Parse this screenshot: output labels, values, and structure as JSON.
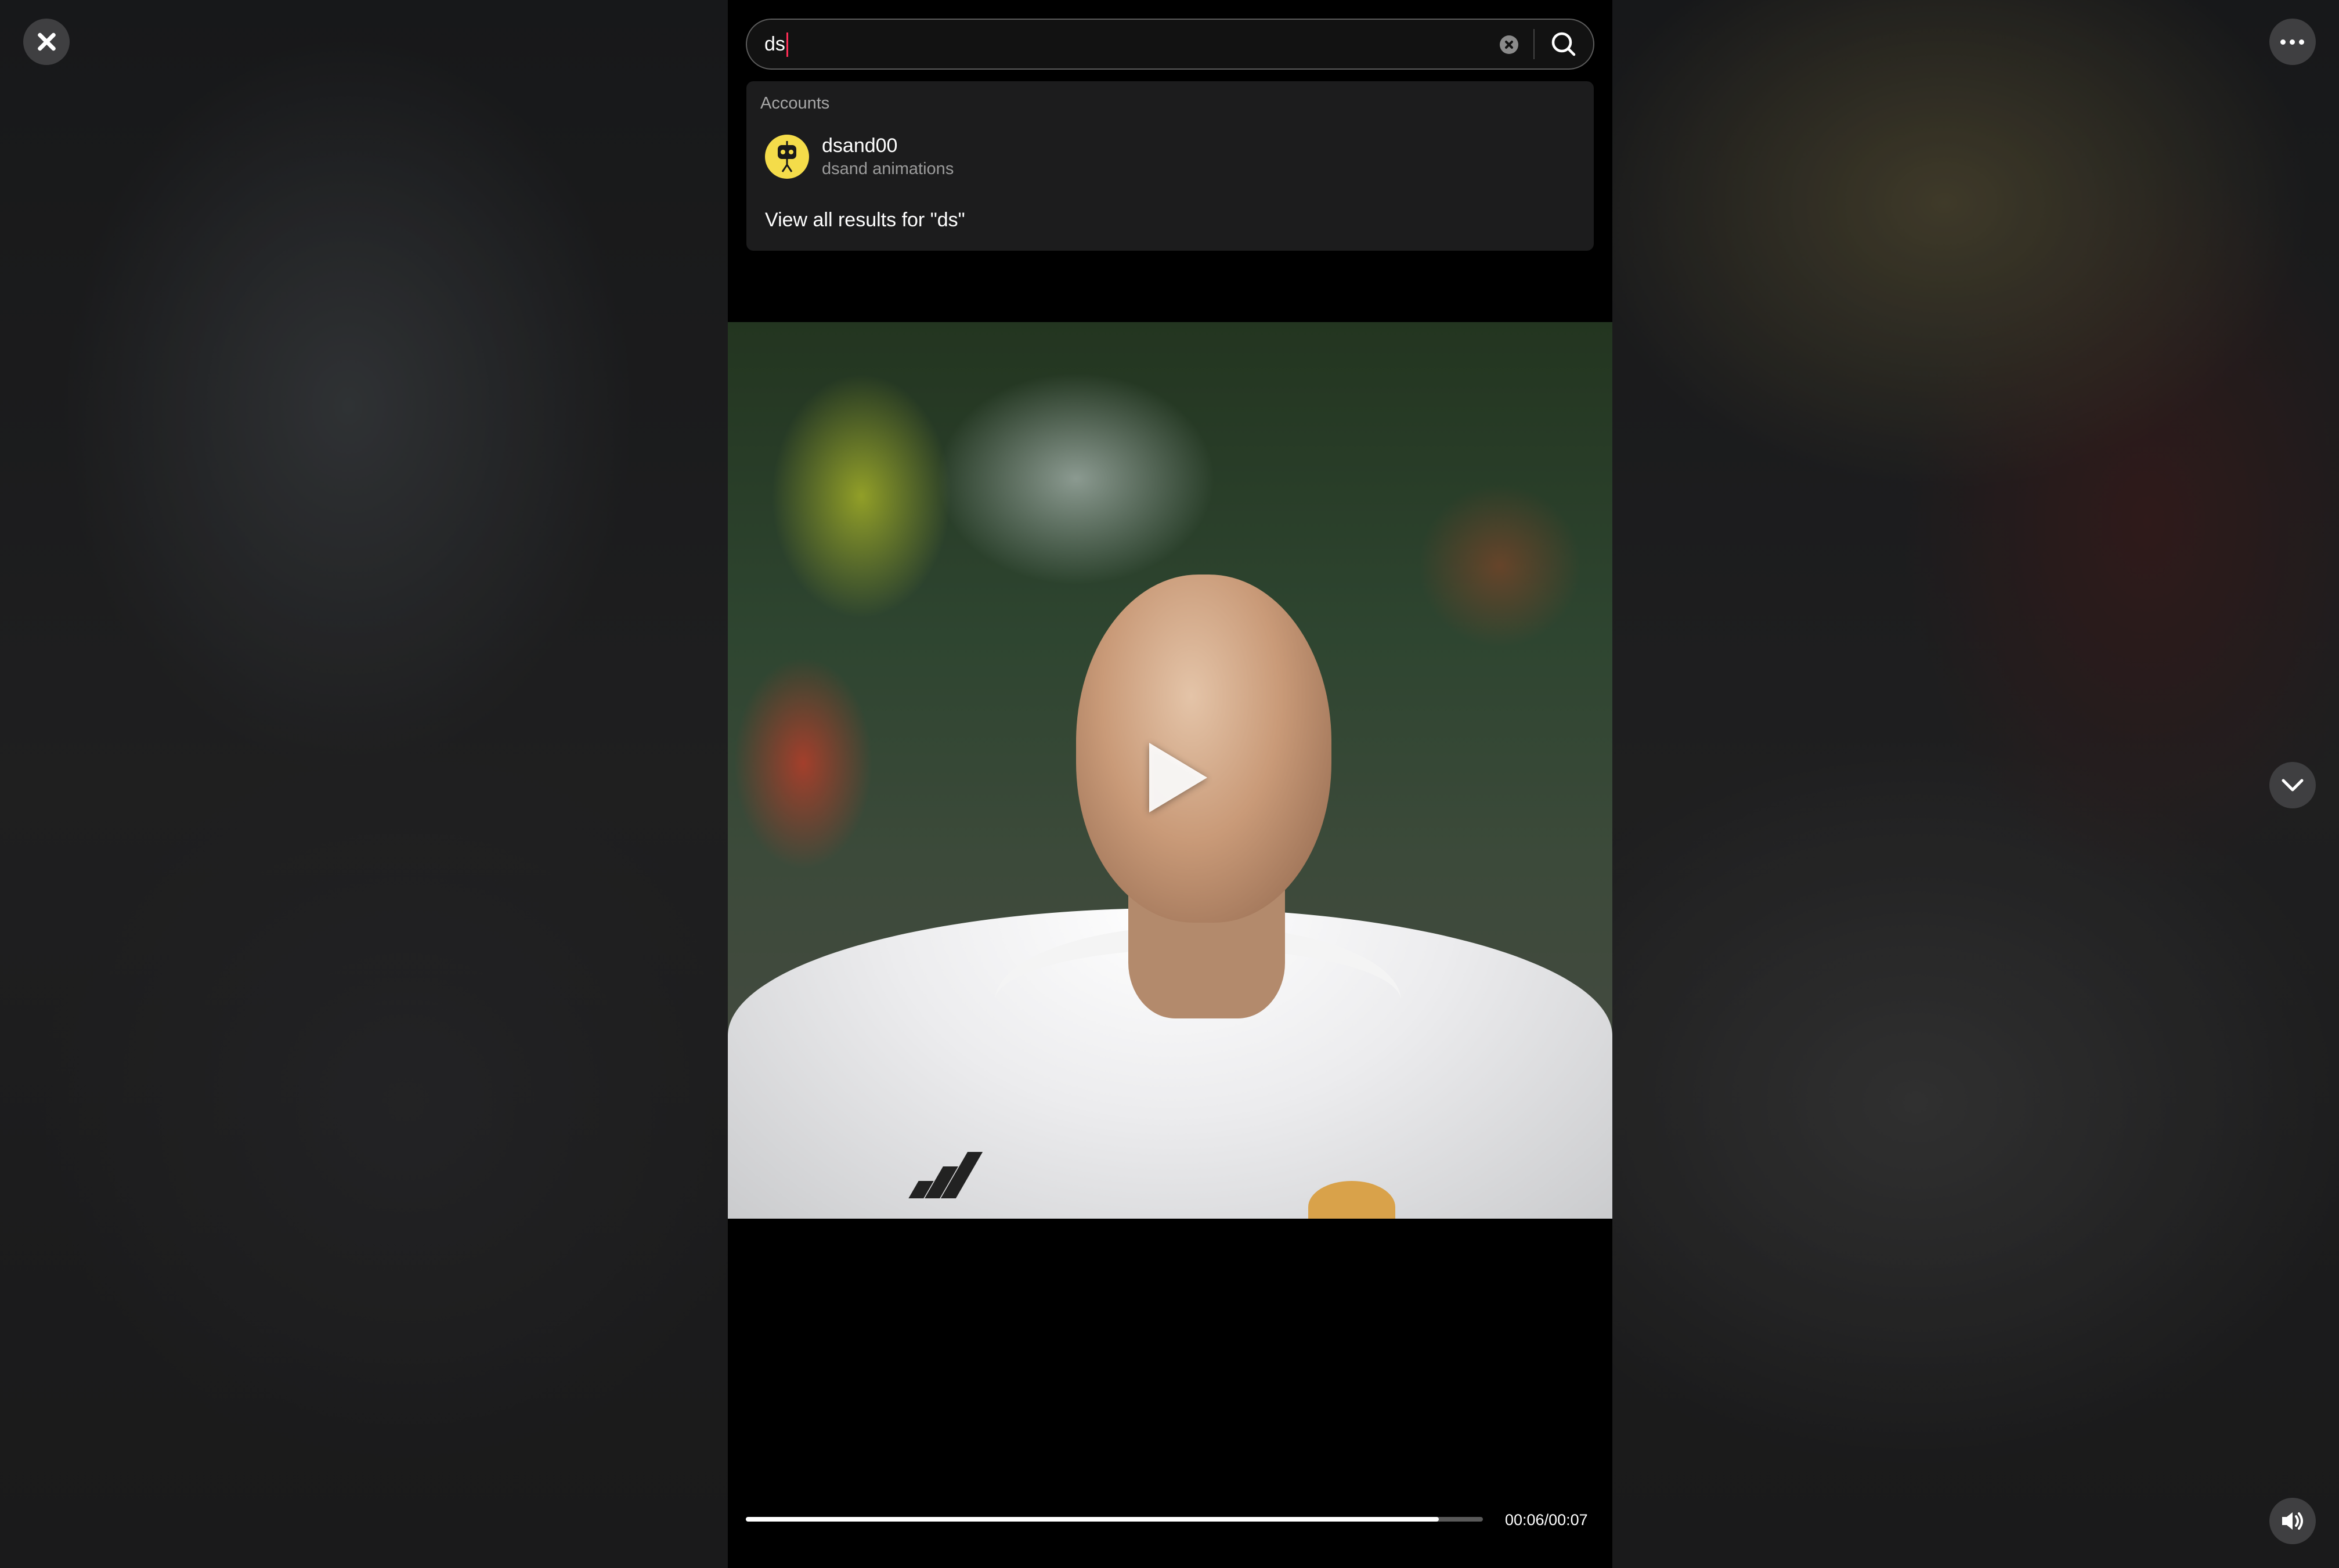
{
  "search": {
    "value": "ds",
    "placeholder": "Search"
  },
  "dropdown": {
    "section_title": "Accounts",
    "accounts": [
      {
        "username": "dsand00",
        "display_name": "dsand animations",
        "avatar_icon": "robot-avatar"
      }
    ],
    "view_all_label": "View all results for \"ds\""
  },
  "video": {
    "progress_fraction": 0.94,
    "current_time": "00:06",
    "duration": "00:07",
    "time_readout": "00:06/00:07",
    "state": "paused"
  },
  "icons": {
    "close": "close-icon",
    "more": "more-icon",
    "next": "chevron-down-icon",
    "volume": "volume-icon",
    "search": "search-icon",
    "clear": "clear-icon",
    "play": "play-icon"
  },
  "colors": {
    "accent_caret": "#fe2c55",
    "panel_bg": "#1c1c1d",
    "button_bg": "#3f3f41"
  }
}
